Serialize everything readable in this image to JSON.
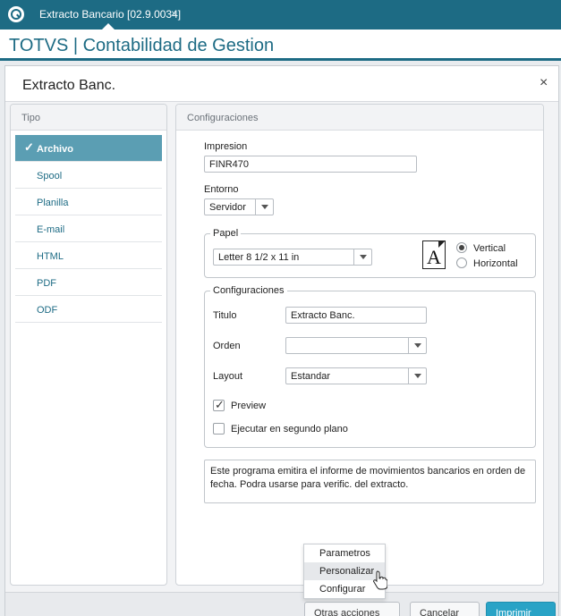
{
  "top_tab": {
    "label": "Extracto Bancario [02.9.0034]",
    "close": "×"
  },
  "app": {
    "title": "TOTVS | Contabilidad de Gestion"
  },
  "dialog": {
    "title": "Extracto Banc.",
    "close": "×",
    "type_panel": {
      "header": "Tipo",
      "items": [
        {
          "label": "Archivo",
          "selected": true
        },
        {
          "label": "Spool"
        },
        {
          "label": "Planilla"
        },
        {
          "label": "E-mail"
        },
        {
          "label": "HTML"
        },
        {
          "label": "PDF"
        },
        {
          "label": "ODF"
        }
      ]
    },
    "config_panel": {
      "header": "Configuraciones",
      "impresion": {
        "label": "Impresion",
        "value": "FINR470"
      },
      "entorno": {
        "label": "Entorno",
        "value": "Servidor"
      },
      "papel": {
        "legend": "Papel",
        "size": "Letter 8 1/2 x 11 in",
        "icon_letter": "A",
        "orientation": [
          {
            "label": "Vertical",
            "selected": true
          },
          {
            "label": "Horizontal",
            "selected": false
          }
        ]
      },
      "configuraciones": {
        "legend": "Configuraciones",
        "titulo": {
          "label": "Titulo",
          "value": "Extracto Banc."
        },
        "orden": {
          "label": "Orden",
          "value": ""
        },
        "layout": {
          "label": "Layout",
          "value": "Estandar"
        },
        "preview": {
          "label": "Preview",
          "checked": true
        },
        "segundo_plano": {
          "label": "Ejecutar en segundo plano",
          "checked": false
        }
      },
      "description": "Este programa emitira el informe de movimientos bancarios en orden de fecha. Podra usarse para  verific. del extracto."
    },
    "footer": {
      "buttons": [
        {
          "label": "Otras acciones",
          "primary": false
        },
        {
          "label": "Cancelar",
          "primary": false
        },
        {
          "label": "Imprimir",
          "primary": true
        }
      ]
    },
    "popup_menu": [
      {
        "label": "Parametros"
      },
      {
        "label": "Personalizar",
        "hover": true
      },
      {
        "label": "Configurar"
      }
    ]
  },
  "colors": {
    "brand": "#1d6b84",
    "selected_item": "#5b9eb3",
    "primary_button": "#29a3c6"
  }
}
